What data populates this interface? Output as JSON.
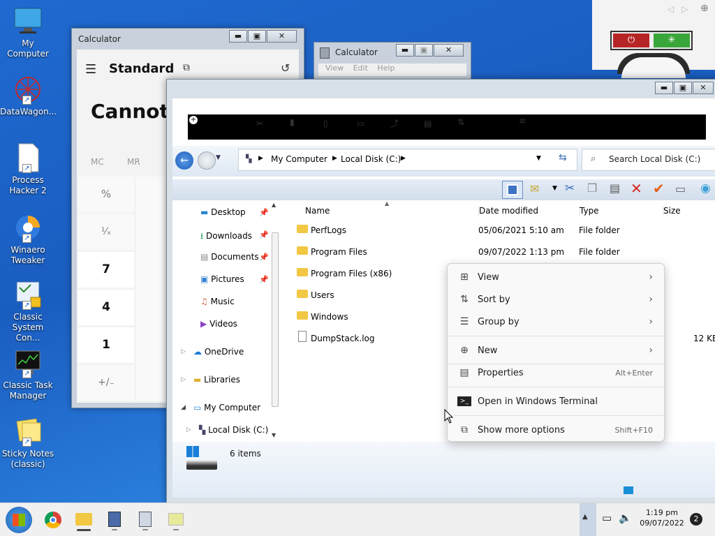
{
  "desktop_icons": [
    {
      "label": "My Computer"
    },
    {
      "label": "DataWagon..."
    },
    {
      "label": "Process\nHacker 2"
    },
    {
      "label": "Winaero\nTweaker"
    },
    {
      "label": "Classic\nSystem Con..."
    },
    {
      "label": "Classic Task\nManager"
    },
    {
      "label": "Sticky Notes\n(classic)"
    }
  ],
  "calculator_modern": {
    "title": "Calculator",
    "mode": "Standard",
    "display": "Cannot",
    "memory_buttons": [
      "MC",
      "MR"
    ],
    "keys": [
      "%",
      "¹⁄ₓ",
      "7",
      "4",
      "1",
      "+/₋"
    ]
  },
  "calculator_classic": {
    "title": "Calculator",
    "menu": [
      "View",
      "Edit",
      "Help"
    ]
  },
  "explorer": {
    "address": {
      "segments": [
        "My Computer",
        "Local Disk (C:)"
      ]
    },
    "search_placeholder": "Search Local Disk (C:)",
    "nav": [
      {
        "label": "Desktop",
        "pinned": true
      },
      {
        "label": "Downloads",
        "pinned": true
      },
      {
        "label": "Documents",
        "pinned": true
      },
      {
        "label": "Pictures",
        "pinned": true
      },
      {
        "label": "Music",
        "pinned": false
      },
      {
        "label": "Videos",
        "pinned": false
      },
      {
        "label": "OneDrive"
      },
      {
        "label": "Libraries"
      },
      {
        "label": "My Computer"
      },
      {
        "label": "Local Disk (C:)"
      }
    ],
    "columns": {
      "name": "Name",
      "date": "Date modified",
      "type": "Type",
      "size": "Size"
    },
    "files": [
      {
        "name": "PerfLogs",
        "date": "05/06/2021 5:10 am",
        "type": "File folder",
        "size": "",
        "kind": "folder"
      },
      {
        "name": "Program Files",
        "date": "09/07/2022 1:13 pm",
        "type": "File folder",
        "size": "",
        "kind": "folder"
      },
      {
        "name": "Program Files (x86)",
        "date": "",
        "type": "",
        "size": "",
        "kind": "folder"
      },
      {
        "name": "Users",
        "date": "",
        "type": "",
        "size": "",
        "kind": "folder"
      },
      {
        "name": "Windows",
        "date": "",
        "type": "",
        "size": "",
        "kind": "folder"
      },
      {
        "name": "DumpStack.log",
        "date": "",
        "type": "",
        "size": "12 KE",
        "kind": "file"
      }
    ],
    "status": "6 items"
  },
  "context_menu": {
    "items": [
      {
        "label": "View",
        "icon": "view-icon",
        "submenu": true
      },
      {
        "label": "Sort by",
        "icon": "sort-icon",
        "submenu": true
      },
      {
        "label": "Group by",
        "icon": "group-icon",
        "submenu": true
      },
      {
        "label": "New",
        "icon": "new-icon",
        "submenu": true
      },
      {
        "label": "Properties",
        "icon": "properties-icon",
        "shortcut": "Alt+Enter"
      },
      {
        "label": "Open in Windows Terminal",
        "icon": "terminal-icon"
      },
      {
        "label": "Show more options",
        "icon": "more-options-icon",
        "shortcut": "Shift+F10"
      }
    ]
  },
  "taskbar": {
    "time": "1:19 pm",
    "date": "09/07/2022",
    "notification_count": "2"
  },
  "colors": {
    "taskbar": "#f0f0f0",
    "desktop": "#1f6ad0",
    "accent": "#0078d4"
  }
}
